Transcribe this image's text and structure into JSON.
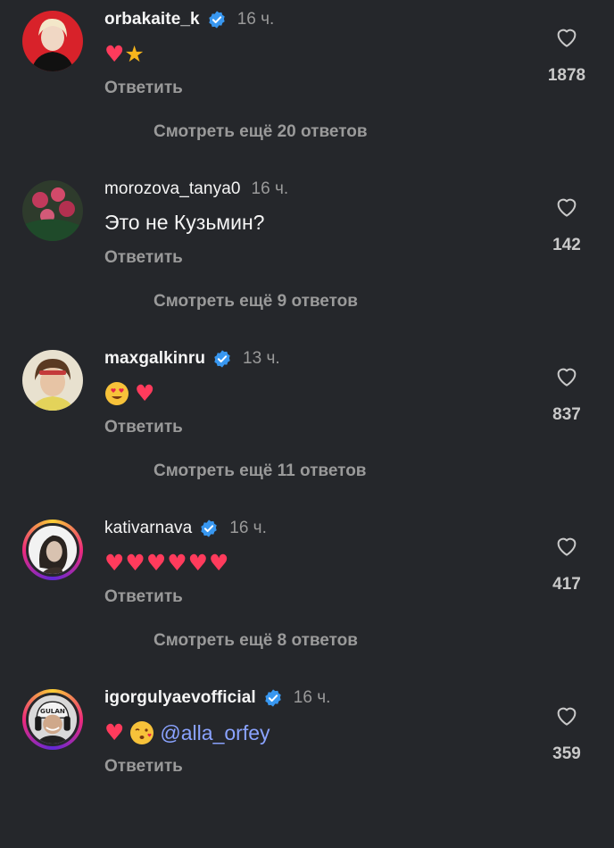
{
  "reply_label": "Ответить",
  "comments": [
    {
      "username": "orbakaite_k",
      "verified": true,
      "time": "16 ч.",
      "text_emojis": "♥★",
      "mention": "",
      "text": "",
      "likes": "1878",
      "more": "Смотреть ещё 20 ответов"
    },
    {
      "username": "morozova_tanya0",
      "verified": false,
      "time": "16 ч.",
      "text_emojis": "",
      "mention": "",
      "text": "Это не Кузьмин?",
      "likes": "142",
      "more": "Смотреть ещё 9 ответов"
    },
    {
      "username": "maxgalkinru",
      "verified": true,
      "time": "13 ч.",
      "text_emojis": "😍♥",
      "mention": "",
      "text": "",
      "likes": "837",
      "more": "Смотреть ещё 11 ответов"
    },
    {
      "username": "kativarnava",
      "verified": true,
      "time": "16 ч.",
      "text_emojis": "♥♥♥♥♥♥",
      "mention": "",
      "text": "",
      "likes": "417",
      "more": "Смотреть ещё 8 ответов"
    },
    {
      "username": "igorgulyaevofficial",
      "verified": true,
      "time": "16 ч.",
      "text_emojis": "♥😘",
      "mention": "@alla_orfey",
      "text": "",
      "likes": "359",
      "more": ""
    }
  ],
  "avatar_art": {
    "0": "GULAN"
  },
  "colors": {
    "background": "#25272b",
    "verified": "#3897f0",
    "heart": "#ff3b5c",
    "mention": "#8aa3ff",
    "muted": "#9a9a9a"
  }
}
